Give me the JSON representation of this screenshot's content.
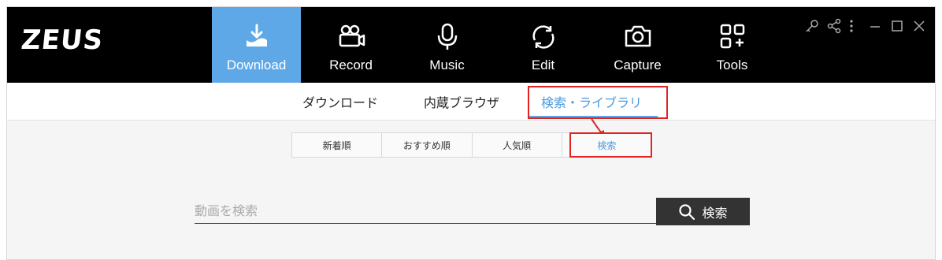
{
  "app": {
    "logo": "ZEUS"
  },
  "nav": {
    "items": [
      {
        "label": "Download",
        "icon": "download-icon",
        "active": true
      },
      {
        "label": "Record",
        "icon": "video-camera-icon",
        "active": false
      },
      {
        "label": "Music",
        "icon": "microphone-icon",
        "active": false
      },
      {
        "label": "Edit",
        "icon": "edit-cycle-icon",
        "active": false
      },
      {
        "label": "Capture",
        "icon": "camera-icon",
        "active": false
      },
      {
        "label": "Tools",
        "icon": "tools-grid-icon",
        "active": false
      }
    ]
  },
  "subnav": {
    "tabs": [
      {
        "label": "ダウンロード",
        "active": false
      },
      {
        "label": "内蔵ブラウザ",
        "active": false
      },
      {
        "label": "検索・ライブラリ",
        "active": true
      }
    ]
  },
  "sort": {
    "items": [
      {
        "label": "新着順"
      },
      {
        "label": "おすすめ順"
      },
      {
        "label": "人気順"
      },
      {
        "label": "検索",
        "active": true
      }
    ]
  },
  "search": {
    "placeholder": "動画を検索",
    "button_label": "検索"
  },
  "colors": {
    "accent": "#5ea8e8",
    "highlight": "#e02424",
    "topbar": "#000000"
  }
}
